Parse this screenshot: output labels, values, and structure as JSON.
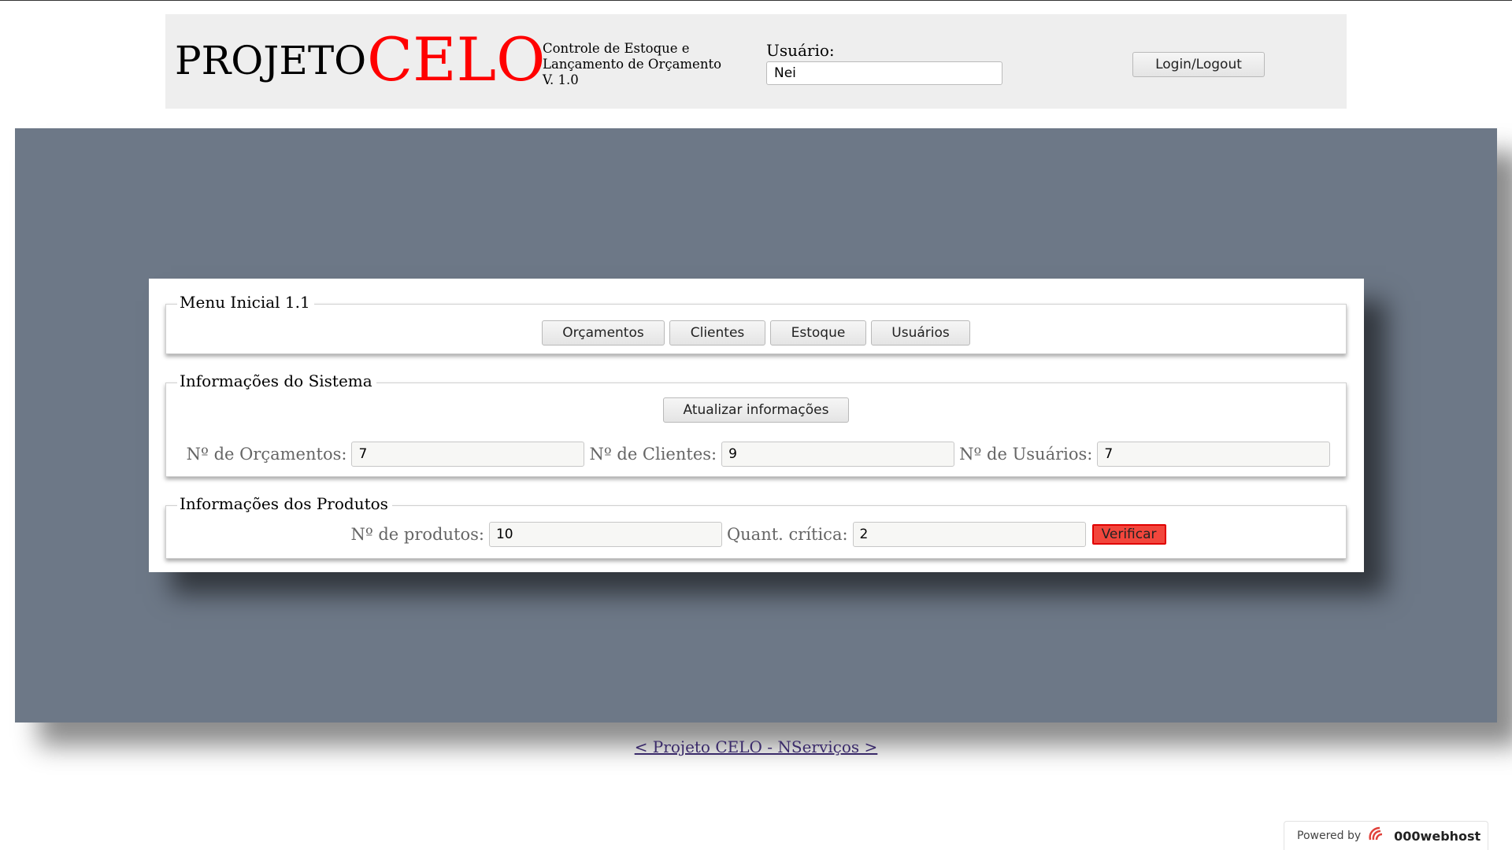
{
  "header": {
    "logo_part1": "PROJETO",
    "logo_part2": "CELO",
    "subtitle_lines": [
      "Controle de Estoque e",
      "Lançamento de Orçamento",
      "V. 1.0"
    ],
    "user_label": "Usuário:",
    "user_value": "Nei",
    "login_button": "Login/Logout"
  },
  "menu": {
    "legend": "Menu Inicial 1.1",
    "buttons": [
      "Orçamentos",
      "Clientes",
      "Estoque",
      "Usuários"
    ]
  },
  "system_info": {
    "legend": "Informações do Sistema",
    "refresh_button": "Atualizar informações",
    "budgets_label": "Nº de Orçamentos:",
    "budgets_value": "7",
    "clients_label": "Nº de Clientes:",
    "clients_value": "9",
    "users_label": "Nº de Usuários:",
    "users_value": "7"
  },
  "products_info": {
    "legend": "Informações dos Produtos",
    "products_label": "Nº de produtos:",
    "products_value": "10",
    "critical_label": "Quant. crítica:",
    "critical_value": "2",
    "verify_button": "Verificar"
  },
  "footer": {
    "link_text": "< Projeto CELO - NServiços >",
    "powered_by": "Powered by",
    "host_name": "000webhost"
  },
  "colors": {
    "stage": "#6d7887",
    "logo_accent": "#ff0000",
    "verify_button": "#f2463c"
  }
}
